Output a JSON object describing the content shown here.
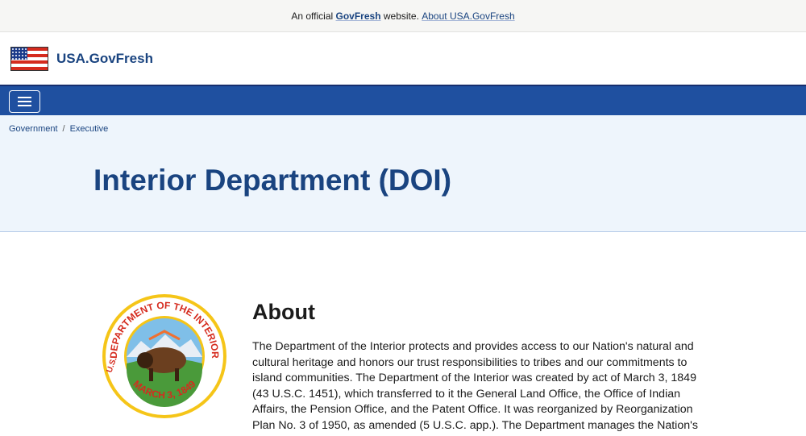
{
  "banner": {
    "prefix": "An official",
    "brand": "GovFresh",
    "middle": "website.",
    "about_link": "About USA.GovFresh"
  },
  "header": {
    "site_name": "USA.GovFresh"
  },
  "nav": {
    "menu_icon": "hamburger-icon"
  },
  "breadcrumb": [
    {
      "label": "Government"
    },
    {
      "label": "Executive"
    }
  ],
  "breadcrumb_sep": "/",
  "page": {
    "title": "Interior Department (DOI)"
  },
  "seal": {
    "top_text": "DEPARTMENT OF THE INTERIOR",
    "left_text": "U.S.",
    "bottom_text": "MARCH 3, 1849"
  },
  "about": {
    "heading": "About",
    "body": "The Department of the Interior protects and provides access to our Nation's natural and cultural heritage and honors our trust responsibilities to tribes and our commitments to island communities. The Department of the Interior was created by act of March 3, 1849 (43 U.S.C. 1451), which transferred to it the General Land Office, the Office of Indian Affairs, the Pension Office, and the Patent Office. It was reorganized by Reorganization Plan No. 3 of 1950, as amended (5 U.S.C. app.). The Department manages the Nation's public lands and"
  }
}
